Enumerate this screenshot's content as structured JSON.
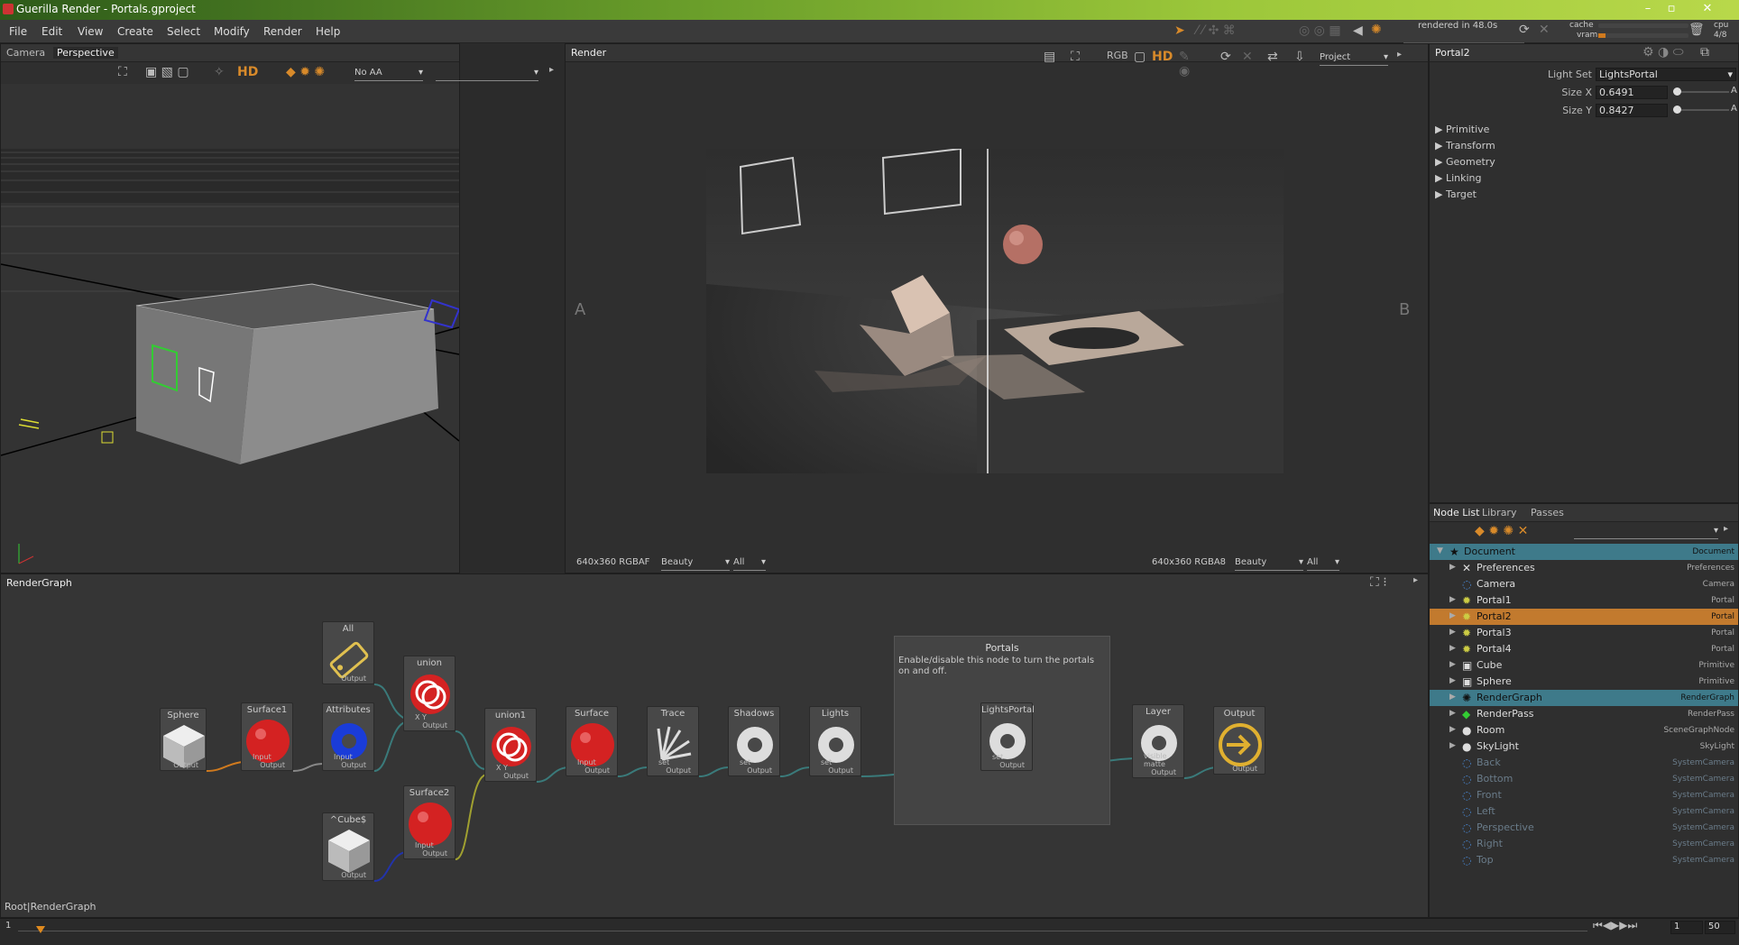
{
  "window": {
    "title": "Guerilla Render - Portals.gproject"
  },
  "menu": [
    "File",
    "Edit",
    "View",
    "Create",
    "Select",
    "Modify",
    "Render",
    "Help"
  ],
  "status": {
    "rendered": "rendered in 48.0s",
    "cache": "cache",
    "vram": "vram",
    "cpu": "cpu",
    "cpu_val": "4/8"
  },
  "viewport": {
    "tab_camera": "Camera",
    "tab_perspective": "Perspective",
    "aa": "No AA",
    "hd": "HD"
  },
  "render": {
    "tab": "Render",
    "project": "Project",
    "label_a": "A",
    "label_b": "B",
    "left_res": "640x360 RGBAF",
    "left_pass": "Beauty",
    "left_filter": "All",
    "right_res": "640x360 RGBA8",
    "right_pass": "Beauty",
    "right_filter": "All",
    "hd": "HD",
    "rgb": "RGB"
  },
  "props": {
    "title": "Portal2",
    "light_set_label": "Light Set",
    "light_set": "LightsPortal",
    "size_x_label": "Size X",
    "size_x": "0.6491",
    "size_y_label": "Size Y",
    "size_y": "0.8427",
    "sections": [
      "Primitive",
      "Transform",
      "Geometry",
      "Linking",
      "Target"
    ],
    "a": "A"
  },
  "nodelist": {
    "tabs": [
      "Node List",
      "Library",
      "Passes"
    ],
    "rows": [
      {
        "name": "Document",
        "type": "Document",
        "icon": "star"
      },
      {
        "name": "Preferences",
        "type": "Preferences",
        "icon": "tools"
      },
      {
        "name": "Camera",
        "type": "Camera",
        "icon": "camera"
      },
      {
        "name": "Portal1",
        "type": "Portal",
        "icon": "light"
      },
      {
        "name": "Portal2",
        "type": "Portal",
        "icon": "light"
      },
      {
        "name": "Portal3",
        "type": "Portal",
        "icon": "light"
      },
      {
        "name": "Portal4",
        "type": "Portal",
        "icon": "light"
      },
      {
        "name": "Cube",
        "type": "Primitive",
        "icon": "cube"
      },
      {
        "name": "Sphere",
        "type": "Primitive",
        "icon": "cube"
      },
      {
        "name": "RenderGraph",
        "type": "RenderGraph",
        "icon": "graph"
      },
      {
        "name": "RenderPass",
        "type": "RenderPass",
        "icon": "pass"
      },
      {
        "name": "Room",
        "type": "SceneGraphNode",
        "icon": "sphere"
      },
      {
        "name": "SkyLight",
        "type": "SkyLight",
        "icon": "sphere"
      },
      {
        "name": "Back",
        "type": "SystemCamera",
        "icon": "camera"
      },
      {
        "name": "Bottom",
        "type": "SystemCamera",
        "icon": "camera"
      },
      {
        "name": "Front",
        "type": "SystemCamera",
        "icon": "camera"
      },
      {
        "name": "Left",
        "type": "SystemCamera",
        "icon": "camera"
      },
      {
        "name": "Perspective",
        "type": "SystemCamera",
        "icon": "camera"
      },
      {
        "name": "Right",
        "type": "SystemCamera",
        "icon": "camera"
      },
      {
        "name": "Top",
        "type": "SystemCamera",
        "icon": "camera"
      }
    ]
  },
  "graph": {
    "title": "RenderGraph",
    "breadcrumb": "Root|RenderGraph",
    "nodes": [
      {
        "label": "Sphere",
        "out": "Output"
      },
      {
        "label": "Surface1",
        "in": "Input",
        "out": "Output"
      },
      {
        "label": "All",
        "out": "Output"
      },
      {
        "label": "Attributes",
        "in": "Input",
        "out": "Output"
      },
      {
        "label": "union",
        "in": "X Y",
        "out": "Output"
      },
      {
        "label": "^Cube$",
        "out": "Output"
      },
      {
        "label": "Surface2",
        "in": "Input",
        "out": "Output"
      },
      {
        "label": "union1",
        "in": "X Y",
        "out": "Output"
      },
      {
        "label": "Surface",
        "in": "Input",
        "out": "Output"
      },
      {
        "label": "Trace",
        "in": "set",
        "out": "Output"
      },
      {
        "label": "Shadows",
        "in": "set",
        "out": "Output"
      },
      {
        "label": "Lights",
        "in": "set",
        "out": "Output"
      },
      {
        "label": "LightsPortal",
        "in": "set",
        "out": "Output"
      },
      {
        "label": "Layer",
        "in": "visible matte",
        "out": "Output"
      },
      {
        "label": "Output",
        "out": "Output"
      }
    ],
    "backdrop": {
      "title": "Portals",
      "text": "Enable/disable this node to turn the portals on and off."
    }
  },
  "timeline": {
    "start": "1",
    "frame": "1",
    "end": "50"
  }
}
